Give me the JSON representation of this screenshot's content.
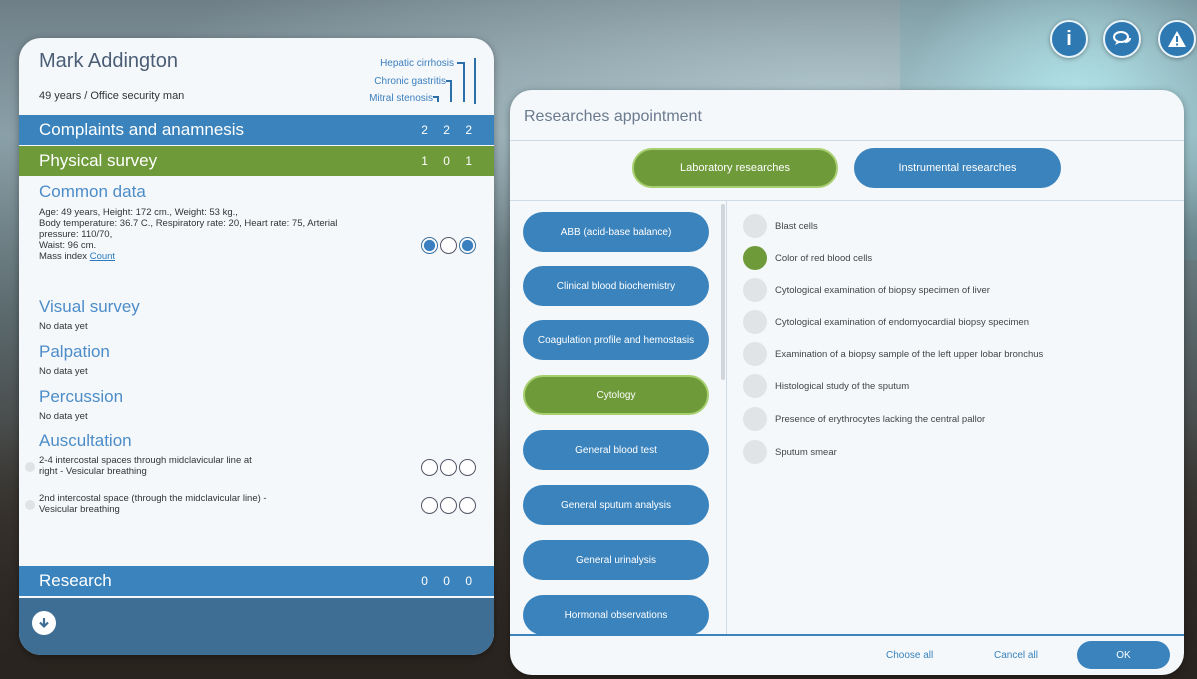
{
  "top_icons": [
    {
      "icon": "info-icon",
      "glyph": "i"
    },
    {
      "icon": "chat-icon",
      "glyph": "🗨"
    },
    {
      "icon": "warning-icon",
      "glyph": "⚠"
    }
  ],
  "patient": {
    "name": "Mark Addington",
    "subtitle": "49 years / Office security man",
    "diagnoses": [
      "Hepatic cirrhosis",
      "Chronic gastritis",
      "Mitral stenosis"
    ]
  },
  "sections": {
    "complaints": {
      "label": "Complaints and anamnesis",
      "counts": "2 2 2"
    },
    "physical": {
      "label": "Physical survey",
      "counts": "1 0 1"
    },
    "research": {
      "label": "Research",
      "counts": "0 0 0"
    }
  },
  "common_data": {
    "title": "Common data",
    "line1": "Age: 49 years, Height: 172 cm., Weight: 53 kg.,",
    "line2": "Body temperature: 36.7 C., Respiratory rate: 20, Heart rate: 75, Arterial",
    "line3": "pressure: 110/70,",
    "line4": "Waist: 96 cm.",
    "mass_label": "Mass index",
    "mass_link": "Count"
  },
  "visual": {
    "title": "Visual survey",
    "text": "No data yet"
  },
  "palpation": {
    "title": "Palpation",
    "text": "No data yet"
  },
  "percussion": {
    "title": "Percussion",
    "text": "No data yet"
  },
  "auscultation": {
    "title": "Auscultation",
    "items": [
      {
        "line1": "2-4 intercostal spaces through midclavicular line at",
        "line2": "right - Vesicular breathing"
      },
      {
        "line1": "2nd intercostal space (through the midclavicular line) -",
        "line2": "Vesicular breathing"
      }
    ]
  },
  "right_panel": {
    "title": "Researches appointment",
    "tabs": [
      "Laboratory researches",
      "Instrumental researches"
    ],
    "categories": [
      "ABB (acid-base balance)",
      "Clinical blood biochemistry",
      "Coagulation profile and hemostasis",
      "Cytology",
      "General blood test",
      "General sputum analysis",
      "General urinalysis",
      "Hormonal observations"
    ],
    "selected_category": "Cytology",
    "items": [
      "Blast cells",
      "Color of red blood cells",
      "Cytological examination of biopsy specimen of liver",
      "Cytological examination of endomyocardial biopsy specimen",
      "Examination of a biopsy sample of the left upper lobar bronchus",
      "Histological study of the sputum",
      "Presence of erythrocytes lacking the central pallor",
      "Sputum smear"
    ],
    "selected_item": "Color of red blood cells",
    "choose_all": "Choose all",
    "cancel_all": "Cancel all",
    "ok": "OK"
  },
  "colors": {
    "blue": "#3a83bd",
    "green": "#6e9a3a",
    "footer": "#3e6e94"
  }
}
